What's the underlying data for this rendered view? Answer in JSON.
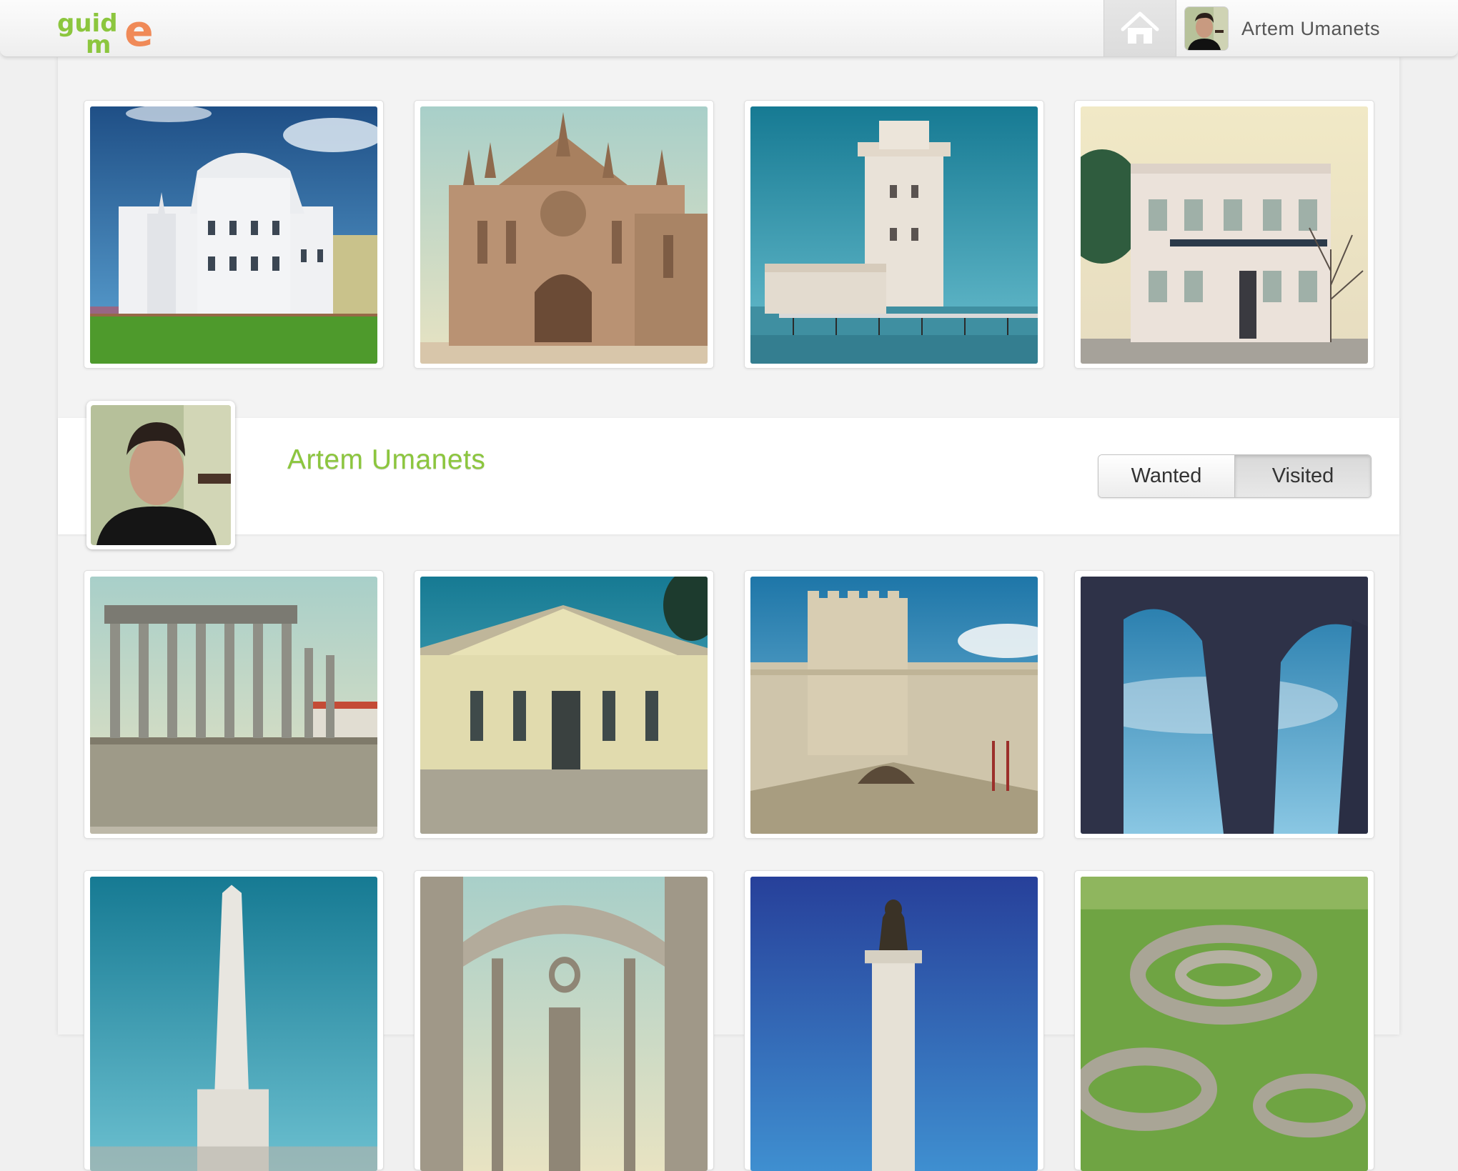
{
  "header": {
    "logo_text": "guide me",
    "user_name": "Artem Umanets"
  },
  "profile": {
    "name": "Artem Umanets",
    "tabs": [
      {
        "label": "Wanted",
        "active": false
      },
      {
        "label": "Visited",
        "active": true
      }
    ]
  },
  "colors": {
    "brand_green": "#8cc63e",
    "brand_orange": "#f08a58"
  },
  "photos": [
    {
      "subject": "palace",
      "icon": "palace-photo"
    },
    {
      "subject": "gothic-monastery",
      "icon": "monastery-photo"
    },
    {
      "subject": "belem-tower",
      "icon": "tower-photo"
    },
    {
      "subject": "townhouse",
      "icon": "townhouse-photo"
    },
    {
      "subject": "roman-temple",
      "icon": "temple-photo"
    },
    {
      "subject": "yellow-house",
      "icon": "house-photo"
    },
    {
      "subject": "castle",
      "icon": "castle-photo"
    },
    {
      "subject": "aqueduct",
      "icon": "aqueduct-photo"
    },
    {
      "subject": "obelisk",
      "icon": "obelisk-photo"
    },
    {
      "subject": "convent-ruins",
      "icon": "ruins-photo"
    },
    {
      "subject": "statue-column",
      "icon": "statue-photo"
    },
    {
      "subject": "stone-ruins",
      "icon": "stone-ruins-photo"
    }
  ]
}
